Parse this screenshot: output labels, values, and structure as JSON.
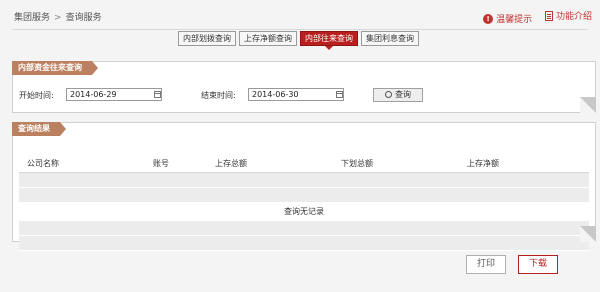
{
  "breadcrumb": {
    "root": "集团服务",
    "separator": ">",
    "current": "查询服务"
  },
  "toplinks": {
    "tips": "温馨提示",
    "tips_icon": "!",
    "help": "功能介绍"
  },
  "tabs": [
    {
      "label": "内部划拨查询",
      "active": false
    },
    {
      "label": "上存净额查询",
      "active": false
    },
    {
      "label": "内部往来查询",
      "active": true
    },
    {
      "label": "集团利息查询",
      "active": false
    }
  ],
  "query_panel": {
    "title": "内部资金往来查询",
    "start_label": "开始时间:",
    "start_value": "2014-06-29",
    "end_label": "结束时间:",
    "end_value": "2014-06-30",
    "search_label": "查询"
  },
  "result_panel": {
    "title": "查询结果",
    "columns": [
      "公司名称",
      "账号",
      "上存总额",
      "下划总额",
      "上存净额"
    ],
    "empty_text": "查询无记录"
  },
  "actions": {
    "print": "打印",
    "download": "下载"
  },
  "colors": {
    "accent": "#b7201f",
    "label_bg": "#bb8060"
  }
}
